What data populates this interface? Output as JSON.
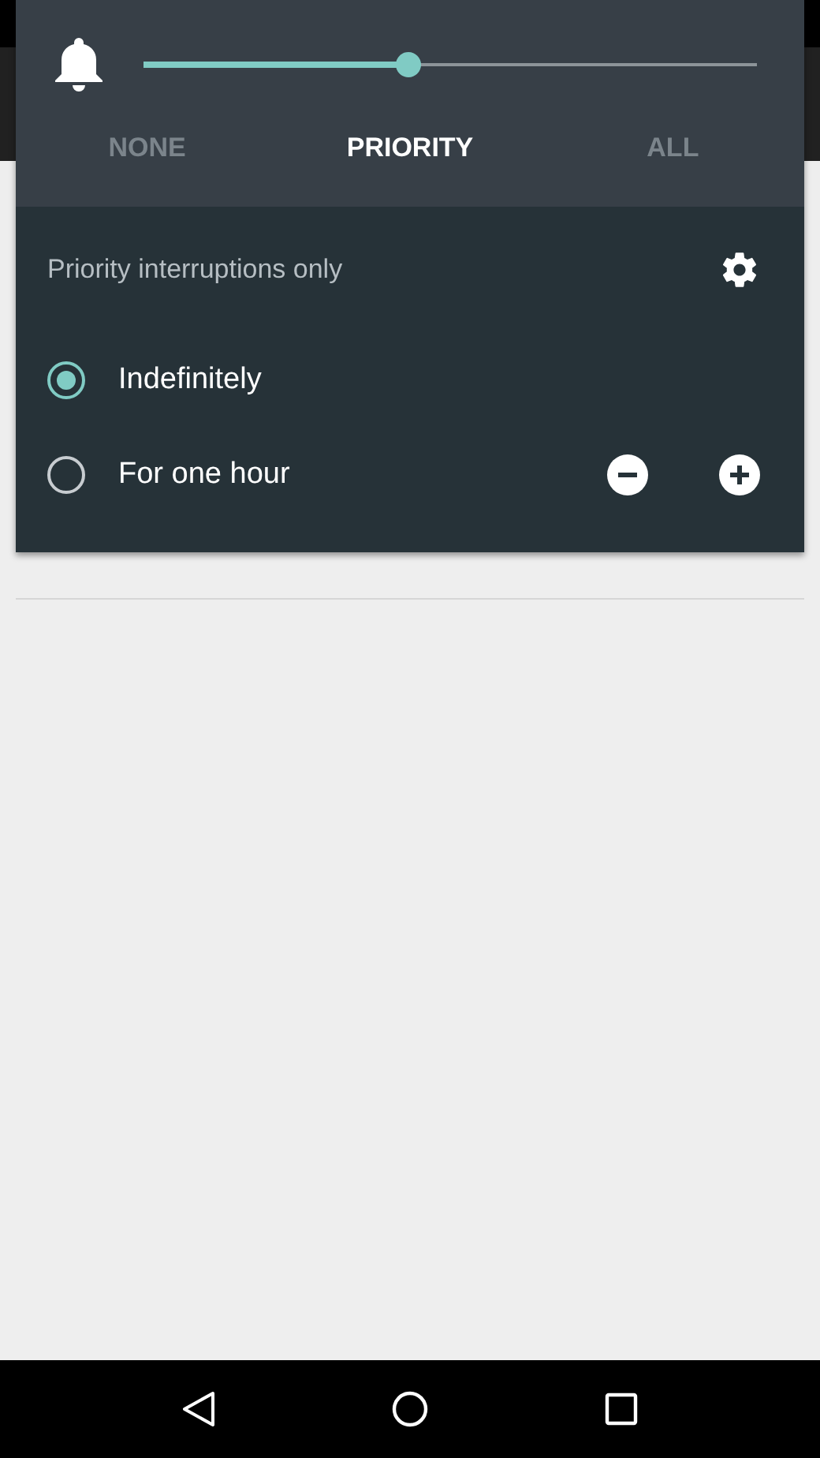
{
  "volume": {
    "level": 0.43
  },
  "tabs": [
    {
      "label": "NONE",
      "selected": false
    },
    {
      "label": "PRIORITY",
      "selected": true
    },
    {
      "label": "ALL",
      "selected": false
    }
  ],
  "mode_title": "Priority interruptions only",
  "options": [
    {
      "label": "Indefinitely",
      "selected": true,
      "kind": "plain"
    },
    {
      "label": "For one hour",
      "selected": false,
      "kind": "stepper"
    }
  ]
}
